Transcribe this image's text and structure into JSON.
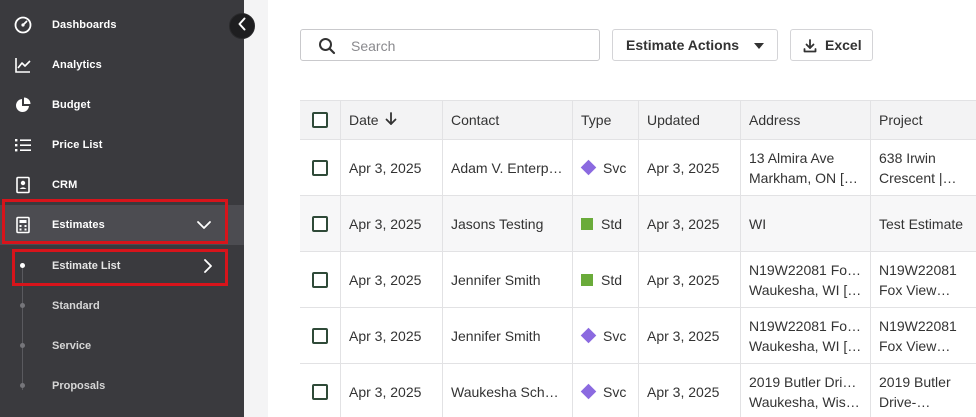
{
  "sidebar": {
    "items": [
      {
        "label": "Dashboards",
        "icon": "gauge-icon"
      },
      {
        "label": "Analytics",
        "icon": "line-chart-icon"
      },
      {
        "label": "Budget",
        "icon": "pie-chart-icon"
      },
      {
        "label": "Price List",
        "icon": "list-icon"
      },
      {
        "label": "CRM",
        "icon": "contact-card-icon"
      },
      {
        "label": "Estimates",
        "icon": "calculator-icon"
      }
    ],
    "sub_items": [
      {
        "label": "Estimate List"
      },
      {
        "label": "Standard"
      },
      {
        "label": "Service"
      },
      {
        "label": "Proposals"
      }
    ],
    "highlight_color": "#d7141b"
  },
  "toolbar": {
    "search_placeholder": "Search",
    "actions_label": "Estimate Actions",
    "excel_label": "Excel"
  },
  "table": {
    "columns": [
      "Date",
      "Contact",
      "Type",
      "Updated",
      "Address",
      "Project"
    ],
    "rows": [
      {
        "date": "Apr 3, 2025",
        "contact": "Adam V. Enterp…",
        "type": "Svc",
        "type_icon": "diamond",
        "updated": "Apr 3, 2025",
        "address1": "13 Almira Ave",
        "address2": "Markham, ON […",
        "project1": "638 Irwin",
        "project2": "Crescent |…"
      },
      {
        "date": "Apr 3, 2025",
        "contact": "Jasons Testing",
        "type": "Std",
        "type_icon": "square",
        "updated": "Apr 3, 2025",
        "address1": "WI",
        "address2": "",
        "project1": "Test Estimate",
        "project2": ""
      },
      {
        "date": "Apr 3, 2025",
        "contact": "Jennifer Smith",
        "type": "Std",
        "type_icon": "square",
        "updated": "Apr 3, 2025",
        "address1": "N19W22081 Fo…",
        "address2": "Waukesha, WI […",
        "project1": "N19W22081",
        "project2": "Fox View…"
      },
      {
        "date": "Apr 3, 2025",
        "contact": "Jennifer Smith",
        "type": "Svc",
        "type_icon": "diamond",
        "updated": "Apr 3, 2025",
        "address1": "N19W22081 Fo…",
        "address2": "Waukesha, WI […",
        "project1": "N19W22081",
        "project2": "Fox View…"
      },
      {
        "date": "Apr 3, 2025",
        "contact": "Waukesha Sch…",
        "type": "Svc",
        "type_icon": "diamond",
        "updated": "Apr 3, 2025",
        "address1": "2019 Butler Dri…",
        "address2": "Waukesha, Wis…",
        "project1": "2019 Butler",
        "project2": "Drive-…"
      }
    ],
    "colors": {
      "svc": "#8b6ae0",
      "std": "#6aab3a"
    }
  }
}
